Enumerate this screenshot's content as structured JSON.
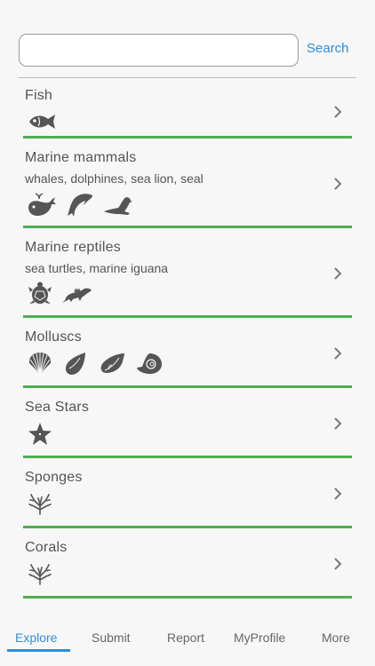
{
  "search": {
    "placeholder": "",
    "button_label": "Search"
  },
  "categories": [
    {
      "title": "Fish",
      "subtitle": "",
      "icons": [
        "fish-icon"
      ]
    },
    {
      "title": "Marine mammals",
      "subtitle": "whales, dolphines, sea lion, seal",
      "icons": [
        "whale-icon",
        "dolphin-icon",
        "seal-icon"
      ]
    },
    {
      "title": "Marine reptiles",
      "subtitle": "sea turtles, marine iguana",
      "icons": [
        "turtle-icon",
        "iguana-icon"
      ]
    },
    {
      "title": "Molluscs",
      "subtitle": "",
      "icons": [
        "scallop-shell-icon",
        "conch-shell-icon",
        "whelk-shell-icon",
        "nautilus-shell-icon"
      ]
    },
    {
      "title": "Sea Stars",
      "subtitle": "",
      "icons": [
        "sea-star-icon"
      ]
    },
    {
      "title": "Sponges",
      "subtitle": "",
      "icons": [
        "sponge-icon"
      ]
    },
    {
      "title": "Corals",
      "subtitle": "",
      "icons": [
        "coral-icon"
      ]
    }
  ],
  "tabs": [
    {
      "label": "Explore",
      "active": true
    },
    {
      "label": "Submit",
      "active": false
    },
    {
      "label": "Report",
      "active": false
    },
    {
      "label": "MyProfile",
      "active": false
    },
    {
      "label": "More",
      "active": false
    }
  ],
  "colors": {
    "accent": "#2b8fd6",
    "divider": "#4caf50",
    "icon": "#555555"
  }
}
